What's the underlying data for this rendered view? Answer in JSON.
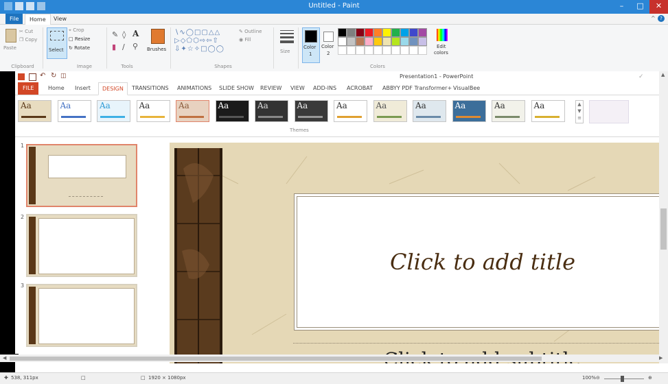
{
  "paint": {
    "window_title": "Untitled - Paint",
    "tabs": [
      "File",
      "Home",
      "View"
    ],
    "clipboard": {
      "paste": "Paste",
      "cut": "Cut",
      "copy": "Copy",
      "label": "Clipboard"
    },
    "image": {
      "select": "Select",
      "crop": "Crop",
      "resize": "Resize",
      "rotate": "Rotate",
      "label": "Image"
    },
    "tools_label": "Tools",
    "brushes": "Brushes",
    "shapes": {
      "outline": "Outline",
      "fill": "Fill",
      "label": "Shapes"
    },
    "size": "Size",
    "color1": "Color",
    "color1_num": "1",
    "color2": "Color",
    "color2_num": "2",
    "edit_colors": "Edit",
    "edit_colors_2": "colors",
    "colors_label": "Colors",
    "palette_row1": [
      "#000000",
      "#7f7f7f",
      "#880015",
      "#ed1c24",
      "#ff7f27",
      "#fff200",
      "#22b14c",
      "#00a2e8",
      "#3f48cc",
      "#a349a4"
    ],
    "palette_row2": [
      "#ffffff",
      "#c3c3c3",
      "#b97a57",
      "#ffaec9",
      "#ffc90e",
      "#efe4b0",
      "#b5e61d",
      "#99d9ea",
      "#7092be",
      "#c8bfe7"
    ]
  },
  "powerpoint": {
    "title": "Presentation1 - PowerPoint",
    "tabs": [
      "FILE",
      "Home",
      "Insert",
      "DESIGN",
      "TRANSITIONS",
      "ANIMATIONS",
      "SLIDE SHOW",
      "REVIEW",
      "VIEW",
      "ADD-INS",
      "ACROBAT",
      "ABBYY PDF Transformer+",
      "VisualBee"
    ],
    "themes_label": "Themes",
    "theme_thumb_text": "Aa",
    "slide_numbers": [
      "1",
      "2",
      "3"
    ],
    "title_placeholder": "Click to add title",
    "subtitle_placeholder": "Click to add subtitle"
  },
  "status": {
    "cursor": "538, 311px",
    "image_size": "1920 × 1080px",
    "zoom": "100%"
  },
  "colors": {
    "paint_accent": "#1e73be",
    "ppt_accent": "#d24726"
  }
}
